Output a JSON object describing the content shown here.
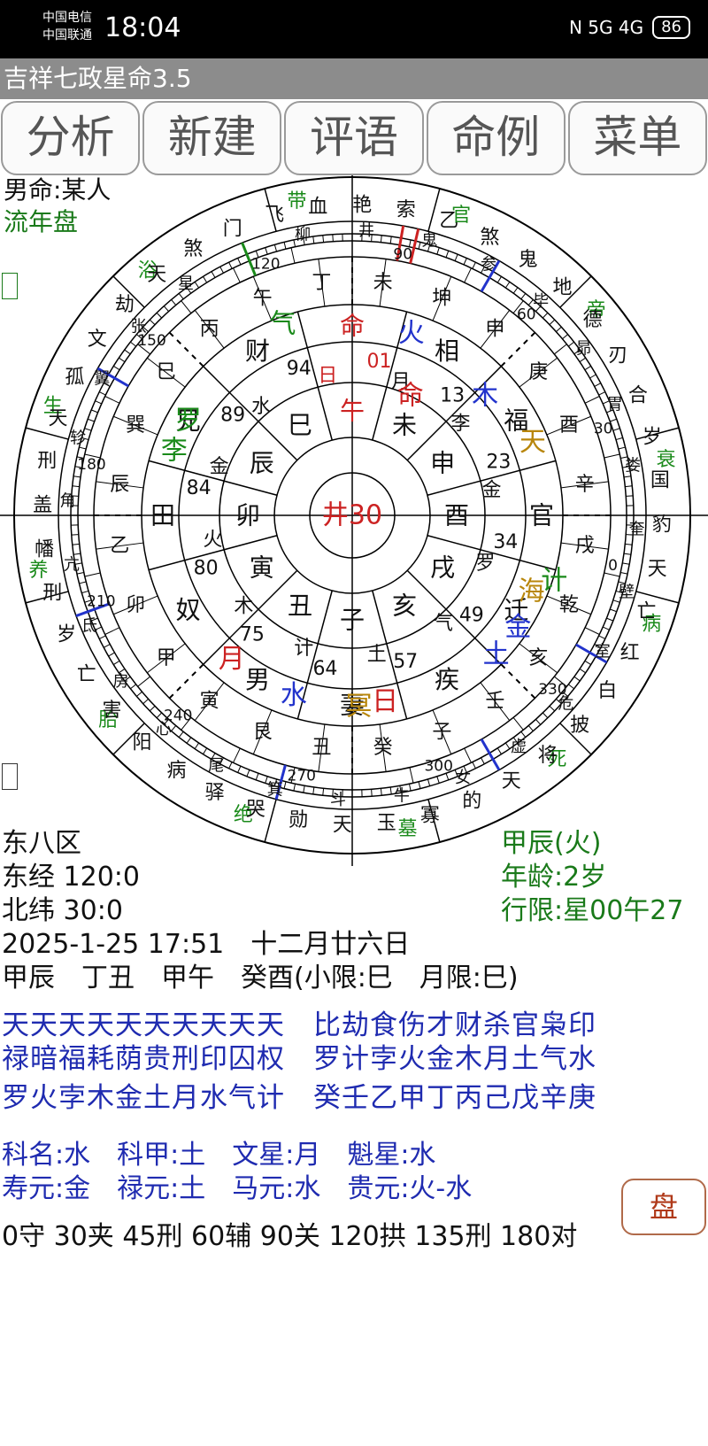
{
  "status": {
    "carrier1": "中国电信",
    "carrier2": "中国联通",
    "time": "18:04",
    "icons": "N 5G 4G",
    "battery": "86"
  },
  "app": {
    "title": "吉祥七政星命3.5"
  },
  "tabs": [
    "分析",
    "新建",
    "评语",
    "命例",
    "菜单"
  ],
  "header": {
    "person": "男命:某人",
    "mode": "流年盘"
  },
  "chart": {
    "center": "井30",
    "ring_gods": [
      "命",
      "相",
      "福",
      "官",
      "迁",
      "疾",
      "妻",
      "男",
      "奴",
      "田",
      "兄",
      "财"
    ],
    "ring_branches": [
      "午",
      "未",
      "申",
      "酉",
      "戌",
      "亥",
      "子",
      "丑",
      "寅",
      "卯",
      "辰",
      "巳"
    ],
    "ring_mid": [
      "丁",
      "未",
      "坤",
      "申",
      "庚",
      "酉",
      "辛",
      "戌",
      "乾",
      "亥",
      "壬",
      "子",
      "癸",
      "丑",
      "艮",
      "寅",
      "甲",
      "卯",
      "乙",
      "辰",
      "巽",
      "巳",
      "丙",
      "午"
    ],
    "inner_labels": [
      "01",
      "13",
      "23",
      "34",
      "49",
      "57",
      "64",
      "75",
      "80",
      "84",
      "89",
      "94"
    ],
    "inner_elements": [
      "日",
      "月",
      "李",
      "金",
      "罗",
      "气",
      "土",
      "计",
      "木",
      "火",
      "金",
      "水"
    ],
    "deg_labels": [
      "120",
      "90",
      "60",
      "30",
      "0",
      "330",
      "300",
      "270",
      "240",
      "210",
      "180",
      "150"
    ],
    "planets": [
      {
        "t": "火",
        "c": "#2233cc"
      },
      {
        "t": "木",
        "c": "#2233cc"
      },
      {
        "t": "天",
        "c": "#b8860b"
      },
      {
        "t": "计",
        "c": "#1a8a1a"
      },
      {
        "t": "海",
        "c": "#b8860b"
      },
      {
        "t": "金",
        "c": "#2233cc"
      },
      {
        "t": "土",
        "c": "#2233cc"
      },
      {
        "t": "日",
        "c": "#cc2222"
      },
      {
        "t": "冥",
        "c": "#b8860b"
      },
      {
        "t": "水",
        "c": "#2233cc"
      },
      {
        "t": "月",
        "c": "#cc2222"
      },
      {
        "t": "李",
        "c": "#1a8a1a"
      },
      {
        "t": "罗",
        "c": "#1a8a1a"
      },
      {
        "t": "气",
        "c": "#1a8a1a"
      },
      {
        "t": "命",
        "c": "#cc2222"
      }
    ],
    "seasons": [
      {
        "t": "带冠",
        "c": "#1a8a1a"
      },
      {
        "t": "官临",
        "c": "#1a8a1a"
      },
      {
        "t": "帝旺",
        "c": "#1a8a1a"
      },
      {
        "t": "衰",
        "c": "#1a8a1a"
      },
      {
        "t": "病",
        "c": "#1a8a1a"
      },
      {
        "t": "死",
        "c": "#1a8a1a"
      },
      {
        "t": "墓",
        "c": "#1a8a1a"
      },
      {
        "t": "绝",
        "c": "#1a8a1a"
      },
      {
        "t": "胎",
        "c": "#1a8a1a"
      },
      {
        "t": "养",
        "c": "#1a8a1a"
      },
      {
        "t": "生长",
        "c": "#1a8a1a"
      },
      {
        "t": "浴沐",
        "c": "#1a8a1a"
      }
    ],
    "outer_words": [
      "索贯",
      "乙天",
      "煞岁",
      "鬼五",
      "地煞",
      "德池",
      "刃解",
      "合霞",
      "岁破",
      "国印",
      "豹尾",
      "天厄",
      "亡神",
      "红鸾",
      "白虎",
      "披头",
      "将星",
      "天德",
      "的杀",
      "寡宿",
      "玉堂",
      "天狗",
      "勋禄",
      "哭亡",
      "驿马",
      "病符",
      "阳刃",
      "害六",
      "亡空",
      "岁太",
      "刑三",
      "幡黄",
      "盖华",
      "刑岁",
      "天空",
      "孤辰",
      "文昌",
      "劫杀",
      "天喜",
      "煞劫",
      "门丧",
      "飞廉",
      "血刃",
      "艳红"
    ],
    "mansions": [
      "柳",
      "井",
      "鬼",
      "参",
      "毕",
      "昴",
      "胃",
      "娄",
      "奎",
      "壁",
      "室",
      "危",
      "虚",
      "女",
      "牛",
      "斗",
      "箕",
      "尾",
      "心",
      "房",
      "氐",
      "亢",
      "角",
      "轸",
      "翼",
      "张",
      "星"
    ]
  },
  "info_left": [
    "东八区",
    "东经 120:0",
    "北纬 30:0",
    "2025-1-25 17:51　十二月廿六日",
    "甲辰　丁丑　甲午　癸酉(小限:巳　月限:巳)"
  ],
  "info_right": [
    "甲辰(火)",
    "年龄:2岁",
    "行限:星00午27"
  ],
  "stars_table": {
    "row1": "天天天天天天天天天天　比劫食伤才财杀官枭印",
    "row2": "禄暗福耗荫贵刑印囚权　罗计孛火金木月土气水",
    "row3": "罗火孛木金土月水气计　癸壬乙甲丁丙己戊辛庚"
  },
  "honors": {
    "line1": "科名:水　科甲:土　文星:月　魁星:水",
    "line2": "寿元:金　禄元:土　马元:水　贵元:火-水"
  },
  "aspects": "0守 30夹 45刑 60辅 90关 120拱 135刑 180对",
  "pan_button": "盘",
  "colors": {
    "title_bg": "#8c8c8c",
    "green": "#1a7a1a",
    "blue": "#1f2bb0",
    "red": "#cc2222",
    "gold": "#b8860b"
  }
}
